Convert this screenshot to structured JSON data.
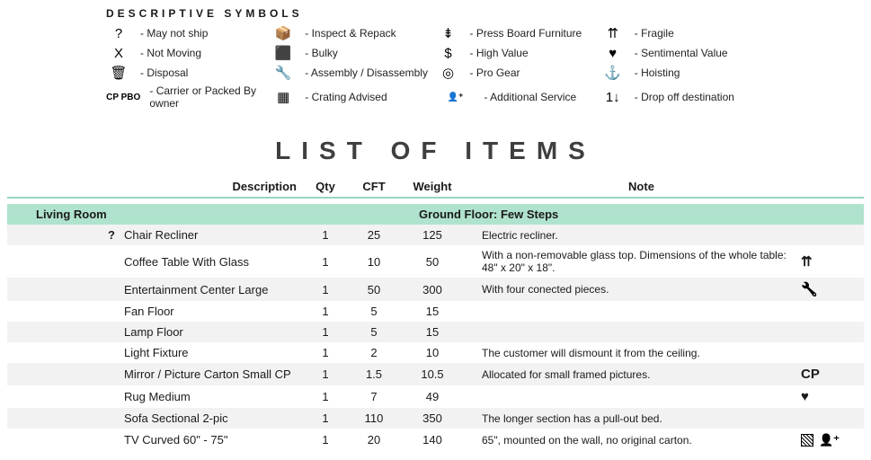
{
  "symbols": {
    "title": "DESCRIPTIVE SYMBOLS",
    "items": [
      {
        "glyph": "?",
        "label": "- May not ship"
      },
      {
        "glyph": "X",
        "label": "- Not Moving"
      },
      {
        "glyph": "🗑",
        "label": "- Disposal"
      },
      {
        "glyph": "CP PBO",
        "label": "- Carrier or Packed By owner"
      },
      {
        "glyph": "📦",
        "label": "- Inspect & Repack"
      },
      {
        "glyph": "⬛",
        "label": "- Bulky"
      },
      {
        "glyph": "🔧",
        "label": "- Assembly / Disassembly"
      },
      {
        "glyph": "▦",
        "label": "- Crating Advised"
      },
      {
        "glyph": "⇟",
        "label": "- Press Board Furniture"
      },
      {
        "glyph": "$",
        "label": "- High Value"
      },
      {
        "glyph": "◎",
        "label": "- Pro Gear"
      },
      {
        "glyph": "👤⁺",
        "label": "- Additional Service"
      },
      {
        "glyph": "⇈",
        "label": "- Fragile"
      },
      {
        "glyph": "♥",
        "label": "- Sentimental Value"
      },
      {
        "glyph": "⚓",
        "label": "- Hoisting"
      },
      {
        "glyph": "1↓",
        "label": "- Drop off destination"
      }
    ]
  },
  "title": "LIST OF ITEMS",
  "headers": {
    "description": "Description",
    "qty": "Qty",
    "cft": "CFT",
    "weight": "Weight",
    "note": "Note"
  },
  "room": {
    "name": "Living Room",
    "note": "Ground Floor: Few Steps"
  },
  "items": [
    {
      "prefix": "?",
      "desc": "Chair Recliner",
      "qty": "1",
      "cft": "25",
      "weight": "125",
      "note": "Electric recliner.",
      "icons": []
    },
    {
      "prefix": "",
      "desc": "Coffee Table With Glass",
      "qty": "1",
      "cft": "10",
      "weight": "50",
      "note": "With a non-removable glass top. Dimensions of the whole table: 48\" x 20\" x 18\".",
      "icons": [
        "fragile"
      ]
    },
    {
      "prefix": "",
      "desc": "Entertainment Center Large",
      "qty": "1",
      "cft": "50",
      "weight": "300",
      "note": "With four conected pieces.",
      "icons": [
        "wrench"
      ]
    },
    {
      "prefix": "",
      "desc": "Fan Floor",
      "qty": "1",
      "cft": "5",
      "weight": "15",
      "note": "",
      "icons": []
    },
    {
      "prefix": "",
      "desc": "Lamp Floor",
      "qty": "1",
      "cft": "5",
      "weight": "15",
      "note": "",
      "icons": []
    },
    {
      "prefix": "",
      "desc": "Light Fixture",
      "qty": "1",
      "cft": "2",
      "weight": "10",
      "note": "The customer will dismount it from the ceiling.",
      "icons": []
    },
    {
      "prefix": "",
      "desc": "Mirror / Picture Carton Small CP",
      "qty": "1",
      "cft": "1.5",
      "weight": "10.5",
      "note": "Allocated for small framed pictures.",
      "icons": [
        "cp"
      ]
    },
    {
      "prefix": "",
      "desc": "Rug Medium",
      "qty": "1",
      "cft": "7",
      "weight": "49",
      "note": "",
      "icons": [
        "heart"
      ]
    },
    {
      "prefix": "",
      "desc": "Sofa Sectional 2-pic",
      "qty": "1",
      "cft": "110",
      "weight": "350",
      "note": "The longer section has a pull-out bed.",
      "icons": []
    },
    {
      "prefix": "",
      "desc": "TV Curved 60\" - 75\"",
      "qty": "1",
      "cft": "20",
      "weight": "140",
      "note": "65\", mounted on the wall, no original carton.",
      "icons": [
        "crate",
        "addsvc"
      ]
    }
  ]
}
